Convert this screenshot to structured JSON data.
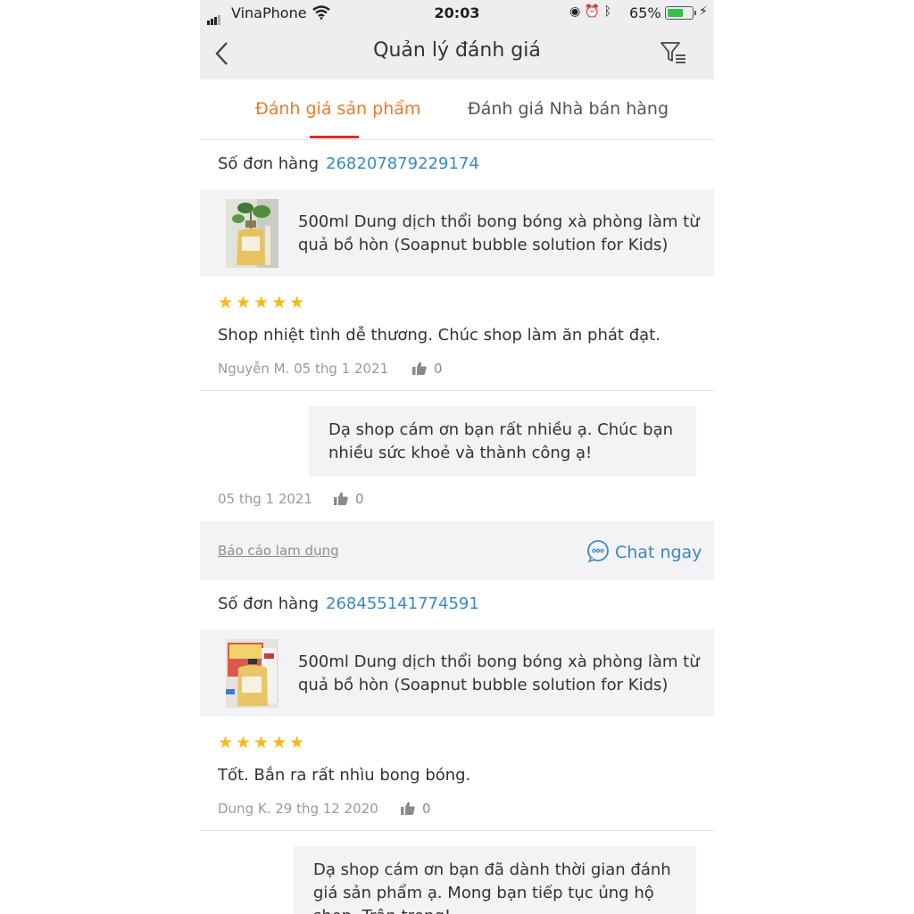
{
  "status_bar": {
    "carrier": "VinaPhone",
    "time": "20:03",
    "battery": "65%",
    "battery_level": 0.65
  },
  "header": {
    "title": "Quản lý đánh giá"
  },
  "tabs": [
    {
      "label": "Đánh giá sản phẩm",
      "active": true
    },
    {
      "label": "Đánh giá Nhà bán hàng",
      "active": false
    }
  ],
  "colors": {
    "accent": "#ee7a2b",
    "tab_underline": "#e02a24",
    "link": "#3a88c8",
    "star": "#f6b91c"
  },
  "reviews": [
    {
      "order_label": "Số đơn hàng",
      "order_number": "268207879229174",
      "product_title": "500ml Dung dịch thổi bong bóng xà phòng làm từ quả bồ hòn (Soapnut bubble solution for Kids)",
      "stars": "★★★★★",
      "rating": 5,
      "text": "Shop nhiệt tình dễ thương. Chúc shop làm ăn phát đạt.",
      "author_date": "Nguyễn M. 05 thg 1 2021",
      "likes": "0",
      "reply": "Dạ shop cám ơn bạn rất nhiều ạ. Chúc bạn nhiều sức khoẻ và thành công ạ!",
      "reply_date": "05 thg 1 2021",
      "reply_likes": "0"
    },
    {
      "order_label": "Số đơn hàng",
      "order_number": "268455141774591",
      "product_title": "500ml Dung dịch thổi bong bóng xà phòng làm từ quả bồ hòn (Soapnut bubble solution for Kids)",
      "stars": "★★★★★",
      "rating": 5,
      "text": "Tốt. Bắn ra rất nhìu bong bóng.",
      "author_date": "Dung K. 29 thg 12 2020",
      "likes": "0",
      "reply": "Dạ shop cám ơn bạn đã dành thời gian đánh giá sản phẩm ạ. Mong bạn tiếp tục ủng hộ shop. Trân trọng!"
    }
  ],
  "actions": {
    "report": "Báo cáo lạm dụng",
    "chat": "Chat ngay"
  }
}
